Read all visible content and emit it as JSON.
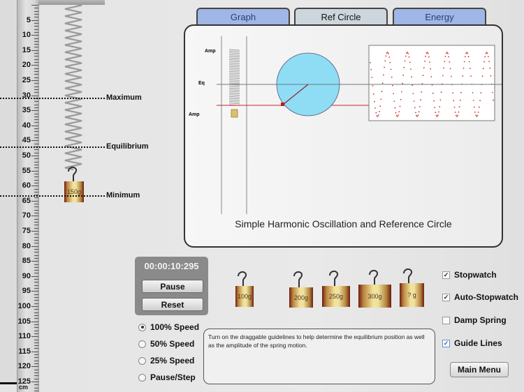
{
  "ruler": {
    "unit": "cm",
    "labels": [
      "5",
      "10",
      "15",
      "20",
      "25",
      "30",
      "35",
      "40",
      "45",
      "50",
      "55",
      "60",
      "65",
      "70",
      "75",
      "80",
      "85",
      "90",
      "95",
      "100",
      "105",
      "110",
      "115",
      "120",
      "125"
    ]
  },
  "guides": {
    "maximum": "Maximum",
    "equilibrium": "Equilibrium",
    "minimum": "Minimum"
  },
  "hanging_mass": {
    "label": "150g"
  },
  "tabs": [
    {
      "label": "Graph",
      "active": false
    },
    {
      "label": "Ref Circle",
      "active": true
    },
    {
      "label": "Energy",
      "active": false
    }
  ],
  "ref_circle_panel": {
    "caption": "Simple Harmonic Oscillation and Reference Circle",
    "labels": {
      "amp_top": "Amp",
      "eq": "Eq",
      "amp_bottom": "Amp"
    },
    "colors": {
      "circle": "#8fdcf5",
      "projection_line": "#cc2222",
      "wave_dots": "#cc3333"
    }
  },
  "stopwatch": {
    "time": "00:00:10:295",
    "pause_label": "Pause",
    "reset_label": "Reset"
  },
  "weights": [
    {
      "label": "100g"
    },
    {
      "label": "200g"
    },
    {
      "label": "250g"
    },
    {
      "label": "300g"
    },
    {
      "label": "? g"
    }
  ],
  "speed_options": [
    {
      "label": "100% Speed",
      "selected": true
    },
    {
      "label": "50% Speed",
      "selected": false
    },
    {
      "label": "25% Speed",
      "selected": false
    },
    {
      "label": "Pause/Step",
      "selected": false
    }
  ],
  "info_text": "Turn on the draggable guidelines to help determine the equilibrium position as well as the amplitude of the spring motion.",
  "options": [
    {
      "label": "Stopwatch",
      "checked": true
    },
    {
      "label": "Auto-Stopwatch",
      "checked": true
    },
    {
      "label": "Damp Spring",
      "checked": false
    },
    {
      "label": "Guide Lines",
      "checked": true
    }
  ],
  "main_menu_label": "Main Menu",
  "icons": {
    "check": "✓"
  }
}
